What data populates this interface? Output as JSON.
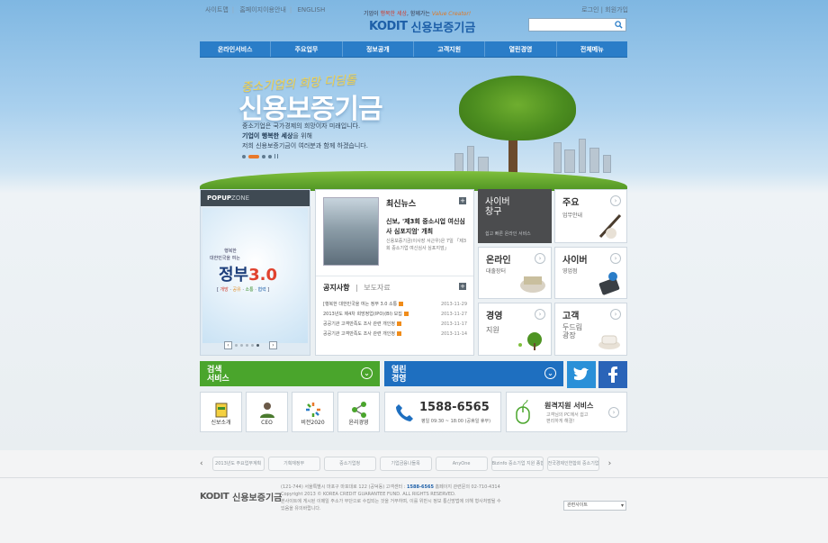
{
  "util": {
    "left": [
      "사이트맵",
      "홈페이지이용안내",
      "ENGLISH"
    ],
    "right": [
      "로그인",
      "회원가입"
    ]
  },
  "header": {
    "tagline_pre": "기업이",
    "tagline_hl": "행복한 세상",
    "tagline_mid": ", 함께가는",
    "tagline_vc": "Value Creator!",
    "logo_mark": "KODIT",
    "logo_text": "신용보증기금",
    "search_placeholder": ""
  },
  "nav": [
    "온라인서비스",
    "주요업무",
    "정보공개",
    "고객지원",
    "열린경영",
    "전체메뉴"
  ],
  "hero": {
    "subtitle": "중소기업의 희망 디딤돌",
    "title": "신용보증기금",
    "line1": "중소기업은 국가경제의 희망이자 미래입니다.",
    "line2_bold": "기업이 행복한 세상",
    "line2_rest": "을 위해",
    "line3": "저희 신용보증기금이 여러분과 함께 하겠습니다."
  },
  "popup": {
    "head_bold": "POPUP",
    "head_rest": "ZONE",
    "small1": "행복한",
    "small2": "대한민국을 여는",
    "big_pre": "정부",
    "big_num": "3.0",
    "tags": [
      "개방",
      "공유",
      "소통",
      "협력"
    ]
  },
  "news": {
    "title": "최신뉴스",
    "headline": "신보, '제3회 중소시업 여신심사 심포지엄' 개최",
    "desc": "신용보증기금(이사장 서근우)은 7일 「제3회 중소기업 여신심사 심포지엄」",
    "tab_on": "공지사항",
    "tab_off": "보도자료",
    "notices": [
      {
        "text": "[행복한 대한민국을 여는 정부 3.0 소통",
        "date": "2013-11-29",
        "new": true
      },
      {
        "text": "2013년도 제4차 희망정업(IPO)(BI) 모집",
        "date": "2013-11-27",
        "new": true
      },
      {
        "text": "공공기관 고객만족도 조사 관련 개인정",
        "date": "2013-11-17",
        "new": true
      },
      {
        "text": "공공기관 고객만족도 조사 관련 개인정",
        "date": "2013-11-14",
        "new": true
      }
    ]
  },
  "tiles": {
    "cyber": {
      "title1": "사이버",
      "title2": "창구",
      "sub": "쉽고 빠른 온라인 서비스"
    },
    "main_work": {
      "title": "주요",
      "sub": "업무안내"
    },
    "online": {
      "title": "온라인",
      "sub": "대출장터"
    },
    "cyber_office": {
      "title": "사이버",
      "sub": "영업점"
    },
    "management": {
      "title": "경영",
      "sub": "지원"
    },
    "customer": {
      "title": "고객",
      "sub": "두드림",
      "sub2": "광장"
    }
  },
  "bands": {
    "search": {
      "line1": "검색",
      "line2": "서비스",
      "color": "#4aa52c"
    },
    "open": {
      "line1": "열린",
      "line2": "경영",
      "color": "#1e6fc0"
    }
  },
  "social": {
    "twitter_color": "#2a90d8",
    "facebook_color": "#2a64b8"
  },
  "quick": [
    {
      "label": "신보소개",
      "icon": "intro-icon"
    },
    {
      "label": "CEO",
      "icon": "ceo-icon"
    },
    {
      "label": "비전2020",
      "icon": "vision-icon"
    },
    {
      "label": "윤리경영",
      "icon": "ethics-icon"
    }
  ],
  "phone": {
    "number": "1588-6565",
    "hours": "평일 09:30 ~ 18:00 (공휴일 휴무)"
  },
  "remote": {
    "title": "원격지원 서비스",
    "sub1": "고객님의 PC에서 쉽고",
    "sub2": "편리하게 해결!"
  },
  "footer_banners": [
    "2013년도 주요업무계획",
    "기획재정부",
    "중소기업청",
    "기업금융나들목",
    "AnyOne",
    "Bizinfo 중소기업 지원 종합정보서비스",
    "전국경제인연합회 중소기업협력센터"
  ],
  "footer": {
    "logo_mark": "KODIT",
    "logo_text": "신용보증기금",
    "address": "(121-744) 서울특별시 마포구 마포대로 122 (공덕동)     고객센터 : ",
    "phone": "1588-6565",
    "privacy": "     홈페이지 관련문의 02-710-4314",
    "copyright": "Copyright 2013 © KOREA CREDIT GUARANTEE FUND. ALL RIGHTS RESERVED.",
    "notice1": "본사이트에 게시된 이메일 주소가 무단으로 수집되는 것을 거부하며, 이를 위반시 정보 통신망법에 의해 형사처벌될 수",
    "notice2": "있음을 유의바랍니다.",
    "related_label": "관련사이트"
  }
}
